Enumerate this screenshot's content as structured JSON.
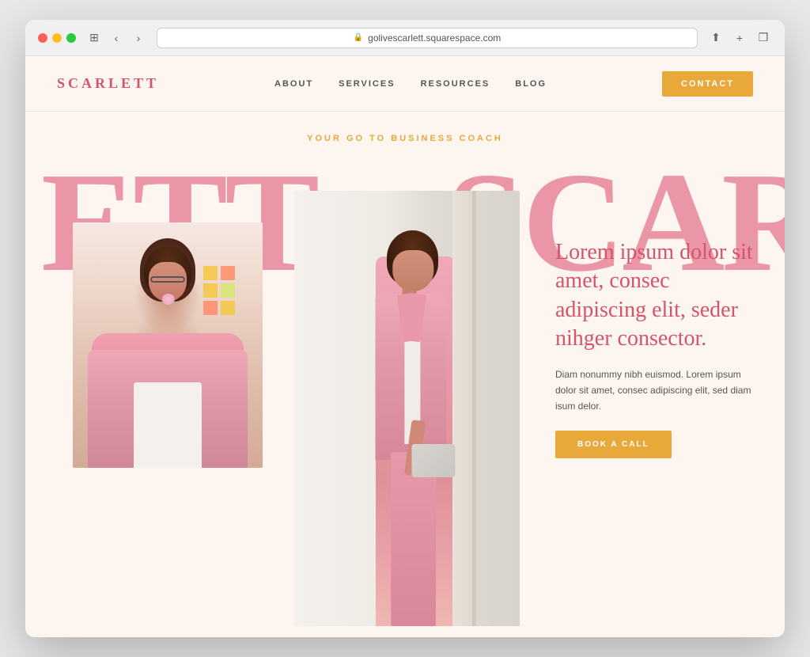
{
  "browser": {
    "url": "golivescarlett.squarespace.com",
    "back_label": "‹",
    "forward_label": "›",
    "window_label": "⊞",
    "share_label": "⬆",
    "new_tab_label": "+",
    "copy_label": "❐"
  },
  "nav": {
    "logo": "SCARLETT",
    "links": [
      {
        "label": "ABOUT"
      },
      {
        "label": "SERVICES"
      },
      {
        "label": "RESOURCES"
      },
      {
        "label": "BLOG"
      }
    ],
    "contact_button": "CONTACT"
  },
  "hero": {
    "subtitle": "YOUR GO TO BUSINESS COACH",
    "big_text": "ETT  SCARLET",
    "big_text_full": "SCARLETT SCARLETT",
    "heading": "Lorem ipsum dolor sit amet, consec adipiscing elit, seder nihger consector.",
    "body": "Diam nonummy nibh euismod. Lorem ipsum dolor sit amet, consec adipiscing elit, sed diam isum delor.",
    "book_button": "BOOK A CALL"
  }
}
